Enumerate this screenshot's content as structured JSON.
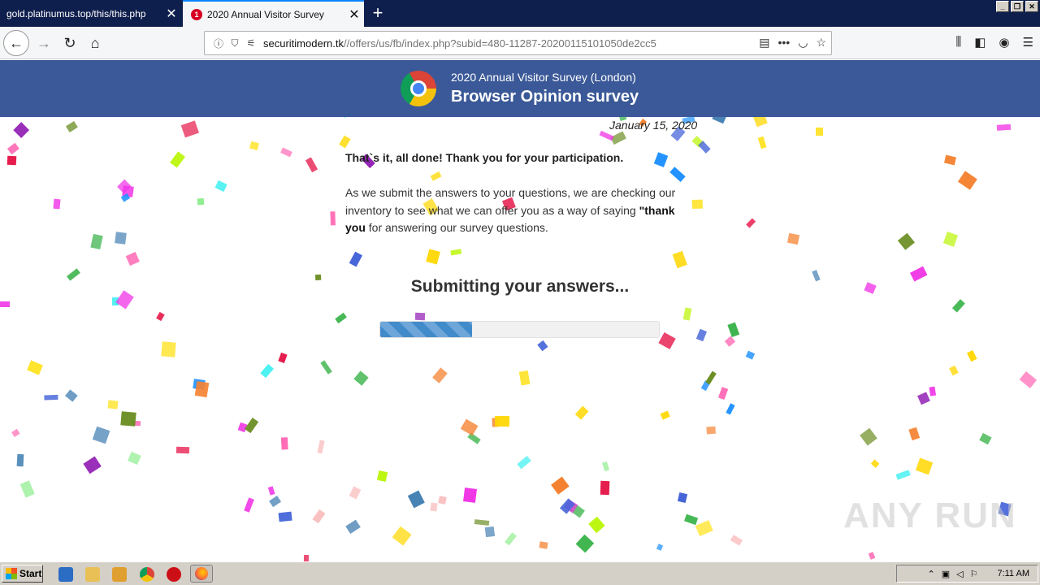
{
  "browser": {
    "tabs": [
      {
        "title": "gold.platinumus.top/this/this.php",
        "active": false
      },
      {
        "title": "2020 Annual Visitor Survey",
        "active": true,
        "badge": "1"
      }
    ],
    "new_tab": "+",
    "url": {
      "domain": "securitimodern.tk",
      "path": "//offers/us/fb/index.php?subid=480-11287-20200115101050de2cc5"
    }
  },
  "page": {
    "survey_subtitle": "2020 Annual Visitor Survey (London)",
    "survey_title": "Browser Opinion survey",
    "date": "January 15, 2020",
    "done_message": "That`s it, all done! Thank you for your participation.",
    "paragraph_before": "As we submit the answers to your questions, we are checking our inventory to see what we can offer you as a way of saying ",
    "paragraph_bold": "\"thank you",
    "paragraph_after": " for answering our survey questions.",
    "submitting_text": "Submitting your answers...",
    "progress": 0.33,
    "watermark": "ANY RUN"
  },
  "taskbar": {
    "start_label": "Start",
    "clock": "7:11 AM"
  },
  "colors": {
    "header_bg": "#3b5998",
    "tabstrip_bg": "#0f1f4d",
    "progress_fill": "#428bca"
  }
}
